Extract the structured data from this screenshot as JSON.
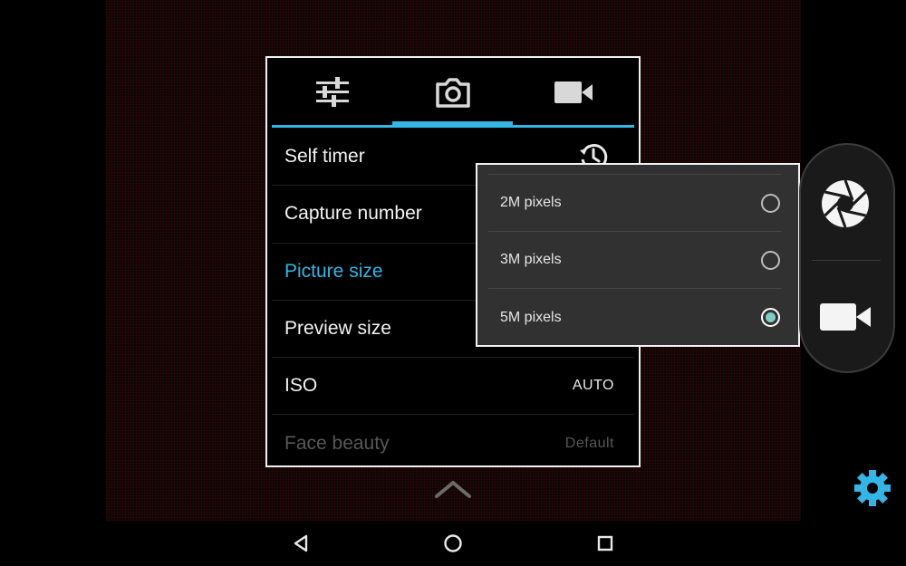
{
  "tabs": [
    {
      "icon": "sliders-icon"
    },
    {
      "icon": "camera-icon",
      "active": true
    },
    {
      "icon": "video-camera-icon"
    }
  ],
  "settings": {
    "items": [
      {
        "label": "Self timer",
        "icon": "timer-icon"
      },
      {
        "label": "Capture number"
      },
      {
        "label": "Picture size",
        "state": "active"
      },
      {
        "label": "Preview size"
      },
      {
        "label": "ISO",
        "value": "AUTO"
      },
      {
        "label": "Face beauty",
        "value": "Default",
        "state": "disabled"
      }
    ]
  },
  "picture_size_popup": {
    "options": [
      {
        "label": "2M pixels",
        "selected": false
      },
      {
        "label": "3M pixels",
        "selected": false
      },
      {
        "label": "5M pixels",
        "selected": true
      }
    ]
  },
  "capsule": {
    "shutter_icon": "shutter-icon",
    "video_icon": "video-camera-icon"
  },
  "controls": {
    "settings_icon": "gear-icon",
    "expand_icon": "chevron-up-icon"
  },
  "nav": {
    "back_icon": "back-icon",
    "home_icon": "home-icon",
    "recents_icon": "recents-icon"
  },
  "colors": {
    "accent": "#33b5e5",
    "radio_checked": "#80cbc4",
    "gear": "#33b5e5"
  }
}
